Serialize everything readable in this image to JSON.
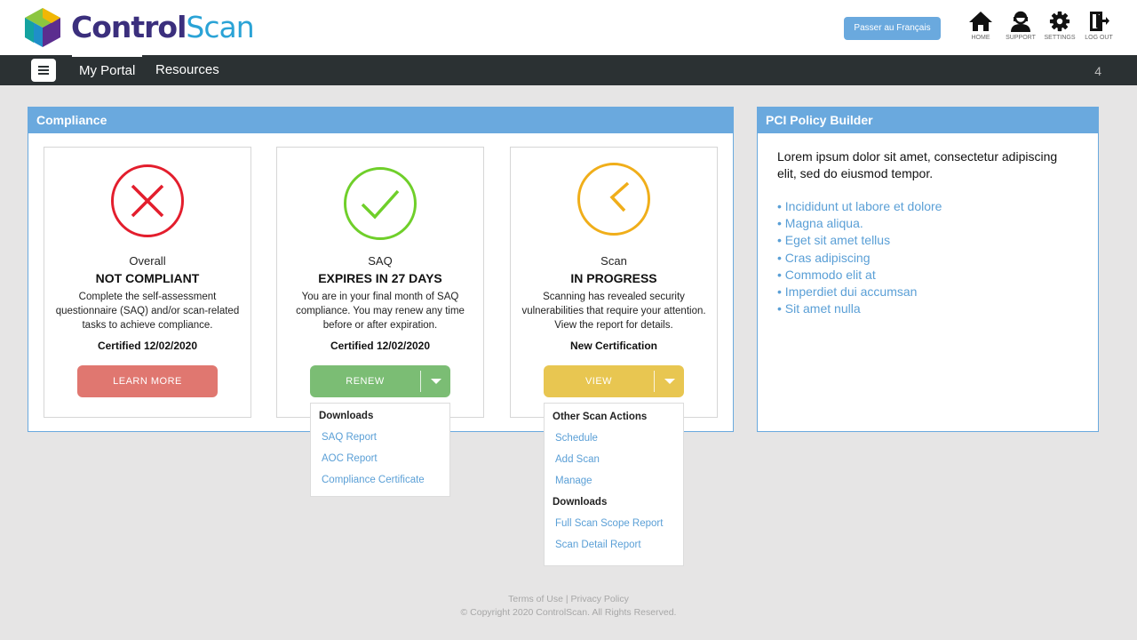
{
  "brand": {
    "part1": "Control",
    "part2": "Scan"
  },
  "header": {
    "language_button": "Passer au Français",
    "icons": [
      {
        "label": "HOME",
        "icon": "home-icon"
      },
      {
        "label": "SUPPORT",
        "icon": "support-agent-icon"
      },
      {
        "label": "SETTINGS",
        "icon": "gear-icon"
      },
      {
        "label": "LOG OUT",
        "icon": "logout-icon"
      }
    ]
  },
  "nav": {
    "tabs": [
      {
        "label": "My Portal",
        "active": true
      },
      {
        "label": "Resources",
        "active": false
      }
    ],
    "count": "4"
  },
  "compliance": {
    "title": "Compliance",
    "cards": [
      {
        "category": "Overall",
        "state": "NOT COMPLIANT",
        "description": "Complete the self-assessment questionnaire (SAQ) and/or scan-related tasks to achieve compliance.",
        "certified": "Certified 12/02/2020",
        "button": "LEARN  MORE",
        "icon": "x-circle-icon",
        "color": "#e31e2d"
      },
      {
        "category": "SAQ",
        "state": "EXPIRES IN 27 DAYS",
        "description": "You are in your final month of SAQ compliance. You may renew any time before or after expiration.",
        "certified": "Certified 12/02/2020",
        "button": "RENEW",
        "icon": "check-circle-icon",
        "color": "#6fcf2a",
        "menu": {
          "heading": "Downloads",
          "items": [
            "SAQ Report",
            "AOC Report",
            "Compliance Certificate"
          ]
        }
      },
      {
        "category": "Scan",
        "state": "IN PROGRESS",
        "description": "Scanning has revealed security vulnerabilities that require your attention. View the  report for details.",
        "certified": "New Certification",
        "button": "VIEW",
        "icon": "clock-icon",
        "color": "#f0ae1a",
        "menu": {
          "heading1": "Other Scan  Actions",
          "items1": [
            "Schedule",
            "Add Scan",
            "Manage"
          ],
          "heading2": "Downloads",
          "items2": [
            "Full Scan Scope Report",
            "Scan Detail Report"
          ]
        }
      }
    ]
  },
  "pci": {
    "title": "PCI Policy Builder",
    "intro": "Lorem ipsum dolor sit amet, consectetur adipiscing elit, sed do eiusmod tempor.",
    "items": [
      "Incididunt ut labore et dolore",
      "Magna aliqua.",
      "Eget sit amet tellus",
      "Cras adipiscing",
      "Commodo  elit at",
      "Imperdiet dui accumsan",
      "Sit amet nulla"
    ]
  },
  "footer": {
    "terms": "Terms of Use",
    "separator": " | ",
    "privacy": "Privacy Policy",
    "copyright": "© Copyright 2020 ControlScan. All Rights Reserved."
  }
}
